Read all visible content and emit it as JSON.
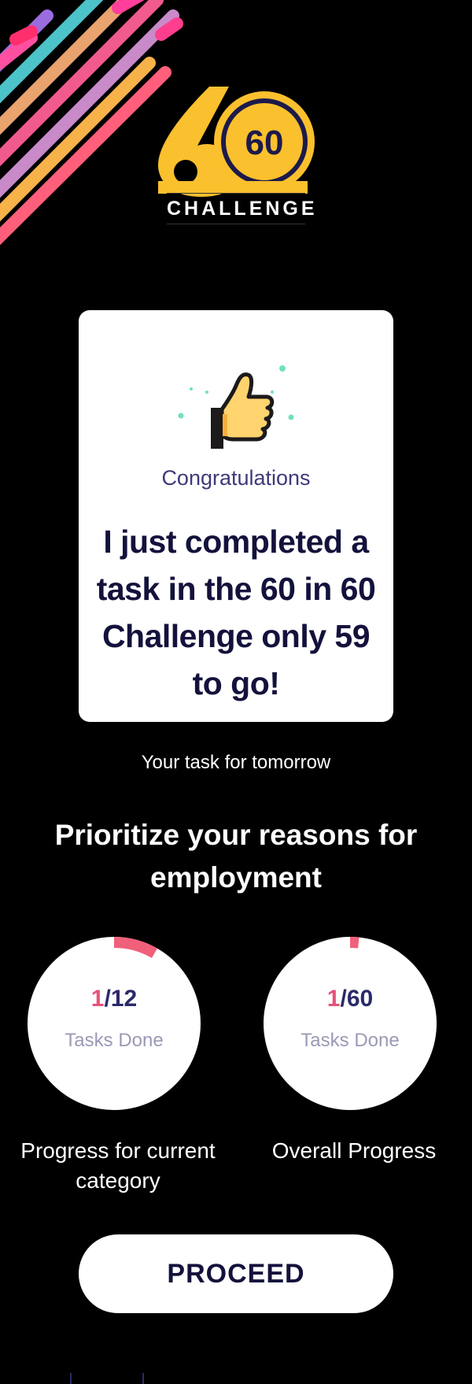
{
  "logo": {
    "number": "60",
    "wordmark": "CHALLENGE",
    "colors": {
      "gold": "#fbc02d",
      "navy": "#1c1a4a"
    }
  },
  "card": {
    "icon": "thumbs-up-icon",
    "congrats": "Congratulations",
    "headline": "I just completed a task in the 60 in 60 Challenge only 59 to go!"
  },
  "tomorrow": {
    "label": "Your task for tomorrow",
    "task": "Prioritize your reasons for employment"
  },
  "progress": [
    {
      "done": "1",
      "total": "/12",
      "fraction": 0.0833,
      "sub": "Tasks Done",
      "caption": "Progress for current category"
    },
    {
      "done": "1",
      "total": "/60",
      "fraction": 0.0167,
      "sub": "Tasks Done",
      "caption": "Overall Progress"
    }
  ],
  "actions": {
    "proceed_label": "PROCEED"
  },
  "colors": {
    "background": "#000000",
    "accent_pink": "#f0607a",
    "navy_text": "#13123c",
    "ring_track": "#ffffff"
  }
}
